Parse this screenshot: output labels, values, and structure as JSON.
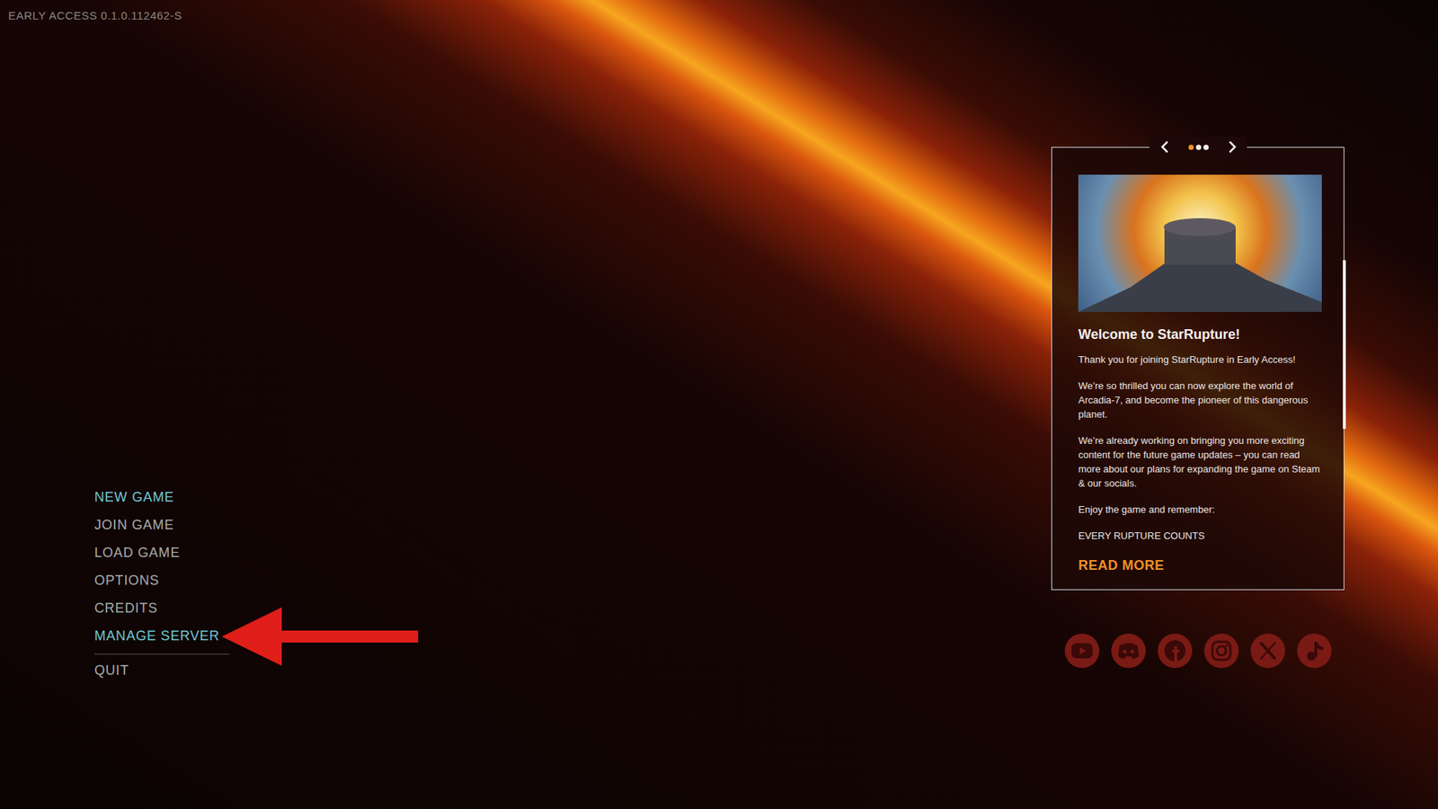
{
  "version": "EARLY ACCESS 0.1.0.112462-S",
  "menu": [
    {
      "label": "NEW GAME",
      "highlighted": true,
      "annotated": false
    },
    {
      "label": "JOIN GAME",
      "highlighted": false,
      "annotated": false
    },
    {
      "label": "LOAD GAME",
      "highlighted": false,
      "annotated": false
    },
    {
      "label": "OPTIONS",
      "highlighted": false,
      "annotated": false
    },
    {
      "label": "CREDITS",
      "highlighted": false,
      "annotated": false
    },
    {
      "label": "MANAGE SERVER",
      "highlighted": true,
      "annotated": true
    },
    {
      "label": "QUIT",
      "highlighted": false,
      "annotated": false
    }
  ],
  "news": {
    "pages": [
      {
        "selected": true
      },
      {
        "selected": false
      },
      {
        "selected": false
      }
    ],
    "title": "Welcome to StarRupture!",
    "paragraphs": [
      "Thank you for joining StarRupture in Early Access!",
      "We’re so thrilled you can now explore the world of Arcadia-7, and become the pioneer of this dangerous planet.",
      "We’re already working on bringing you more exciting content for the future game updates – you can read more about our plans for expanding the game on Steam & our socials.",
      "Enjoy the game and remember:",
      "EVERY RUPTURE COUNTS"
    ],
    "read_more": "READ MORE"
  },
  "socials": [
    {
      "kind": "youtube"
    },
    {
      "kind": "discord"
    },
    {
      "kind": "facebook"
    },
    {
      "kind": "instagram"
    },
    {
      "kind": "x"
    },
    {
      "kind": "tiktok"
    }
  ]
}
